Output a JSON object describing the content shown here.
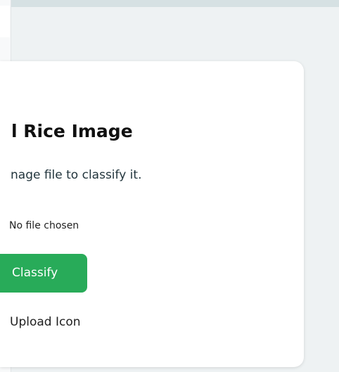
{
  "page": {
    "card": {
      "title": "l Rice Image",
      "description": "nage file to classify it.",
      "file_input_status": "No file chosen",
      "classify_button_label": "Classify",
      "upload_icon_alt_text": "Upload Icon"
    },
    "colors": {
      "background": "#eef2f3",
      "card": "#ffffff",
      "button": "#28ab59",
      "scrollbar": "#a7abad"
    }
  }
}
